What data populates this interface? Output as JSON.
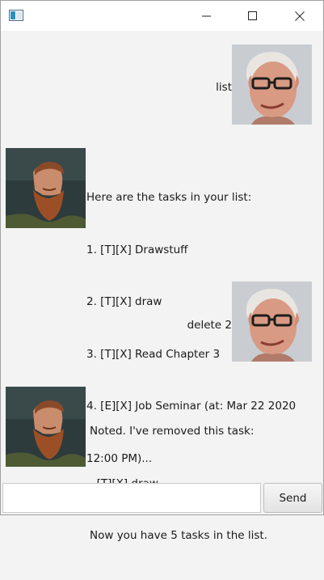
{
  "window": {
    "controls": [
      "minimize-icon",
      "maximize-icon",
      "close-icon"
    ]
  },
  "messages": [
    {
      "sender": "user",
      "lines": [
        "list"
      ]
    },
    {
      "sender": "bot",
      "lines": [
        "Here are the tasks in your list:",
        "1. [T][X] Drawstuff",
        "2. [T][X] draw",
        "3. [T][X] Read Chapter 3",
        "4. [E][X] Job Seminar (at: Mar 22 2020",
        "12:00 PM)..."
      ]
    },
    {
      "sender": "user",
      "lines": [
        "delete 2"
      ]
    },
    {
      "sender": "bot",
      "lines": [
        "Noted. I've removed this task:",
        "  [T][X] draw",
        "Now you have 5 tasks in the list."
      ]
    }
  ],
  "input": {
    "value": "",
    "placeholder": ""
  },
  "send_label": "Send",
  "colors": {
    "window_bg": "#f3f3f3",
    "titlebar_bg": "#ffffff"
  }
}
